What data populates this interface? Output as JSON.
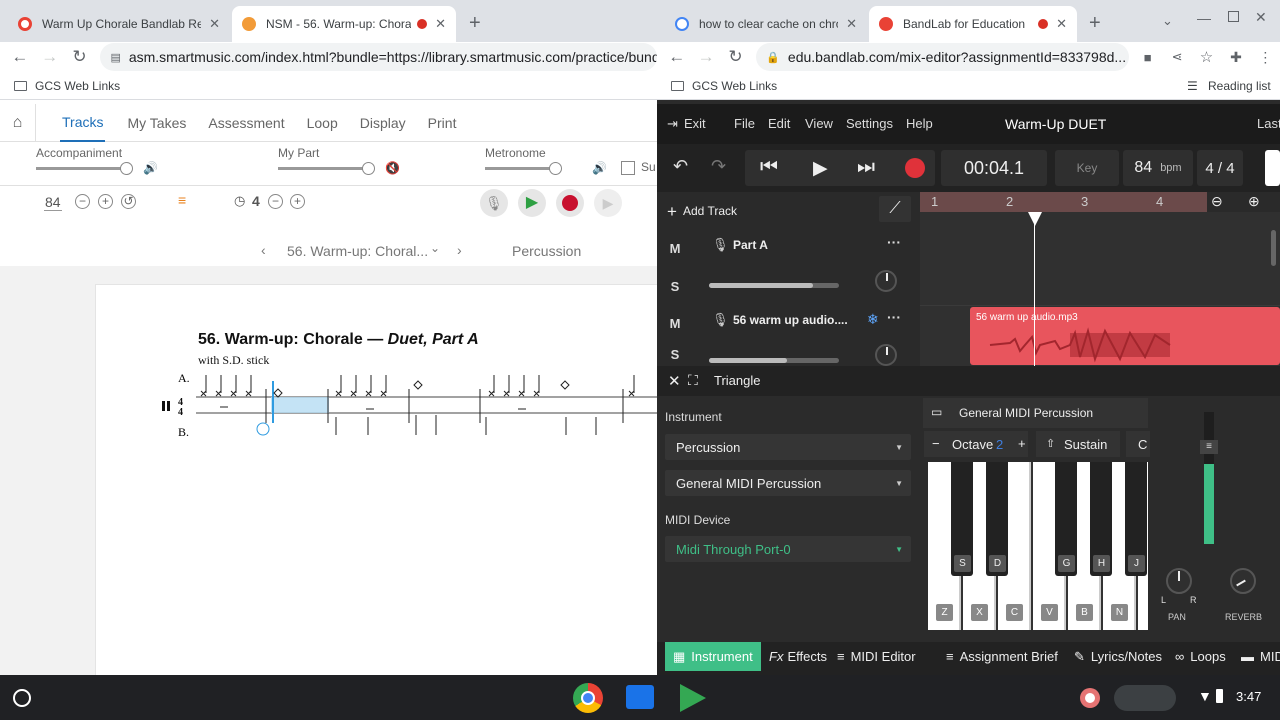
{
  "left": {
    "tabs": [
      {
        "title": "Warm Up Chorale Bandlab Reco",
        "color": "#e94235"
      },
      {
        "title": "NSM - 56. Warm-up: Chorale",
        "color": "#f29b38"
      }
    ],
    "url": "asm.smartmusic.com/index.html?bundle=https://library.smartmusic.com/practice/bundle",
    "bookmark": "GCS Web Links",
    "nav": [
      "Tracks",
      "My Takes",
      "Assessment",
      "Loop",
      "Display",
      "Print"
    ],
    "mixer": {
      "accompaniment": "Accompaniment",
      "my_part": "My Part",
      "metronome": "Metronome",
      "cut": "Su"
    },
    "tempo": "84",
    "count": "4",
    "piece_selector": "56. Warm-up: Choral...",
    "instrument": "Percussion",
    "score": {
      "title": "56. Warm-up: Chorale — ",
      "title_italic": "Duet, Part A",
      "subtitle": "with S.D. stick",
      "part_a": "A.",
      "part_b": "B."
    }
  },
  "right": {
    "tabs": [
      {
        "title": "how to clear cache on chron",
        "color": "#4285f4"
      },
      {
        "title": "BandLab for Education",
        "color": "#e94235"
      }
    ],
    "url": "edu.bandlab.com/mix-editor?assignmentId=833798d...",
    "bookmark": "GCS Web Links",
    "reading_list": "Reading list",
    "menu": {
      "exit": "Exit",
      "file": "File",
      "edit": "Edit",
      "view": "View",
      "settings": "Settings",
      "help": "Help",
      "project": "Warm-Up DUET",
      "last": "Last"
    },
    "time": "00:04.1",
    "key": "Key",
    "bpm": "84",
    "bpm_unit": "bpm",
    "signature": "4 / 4",
    "add_track": "Add Track",
    "ruler": [
      "1",
      "2",
      "3",
      "4"
    ],
    "tracks": [
      {
        "name": "Part A",
        "m": "M",
        "s": "S",
        "volume": 0.8
      },
      {
        "name": "56 warm up audio....",
        "m": "M",
        "s": "S",
        "volume": 0.6
      }
    ],
    "clip_name": "56 warm up audio.mp3",
    "instrument_header": "Triangle",
    "instrument_label": "Instrument",
    "instrument_value": "Percussion",
    "kit_value": "General MIDI Percussion",
    "midi_label": "MIDI Device",
    "midi_value": "Midi Through Port-0",
    "kbd_title": "General MIDI Percussion",
    "octave": "Octave",
    "octave_value": "2",
    "sustain": "Sustain",
    "more": "C",
    "black_keys": [
      "S",
      "D",
      "G",
      "H",
      "J"
    ],
    "white_keys": [
      "Z",
      "X",
      "C",
      "V",
      "B",
      "N"
    ],
    "pan": "PAN",
    "reverb": "REVERB",
    "pan_l": "L",
    "pan_r": "R",
    "bottom_tabs": [
      "Instrument",
      "Effects",
      "MIDI Editor",
      "Assignment Brief",
      "Lyrics/Notes",
      "Loops",
      "MID"
    ],
    "fx_prefix": "Fx"
  },
  "shelf": {
    "clock": "3:47"
  },
  "colors": {
    "bandlab_green": "#3fbf87",
    "clip_red": "#e8555d",
    "sm_blue": "#1e6fb8"
  }
}
